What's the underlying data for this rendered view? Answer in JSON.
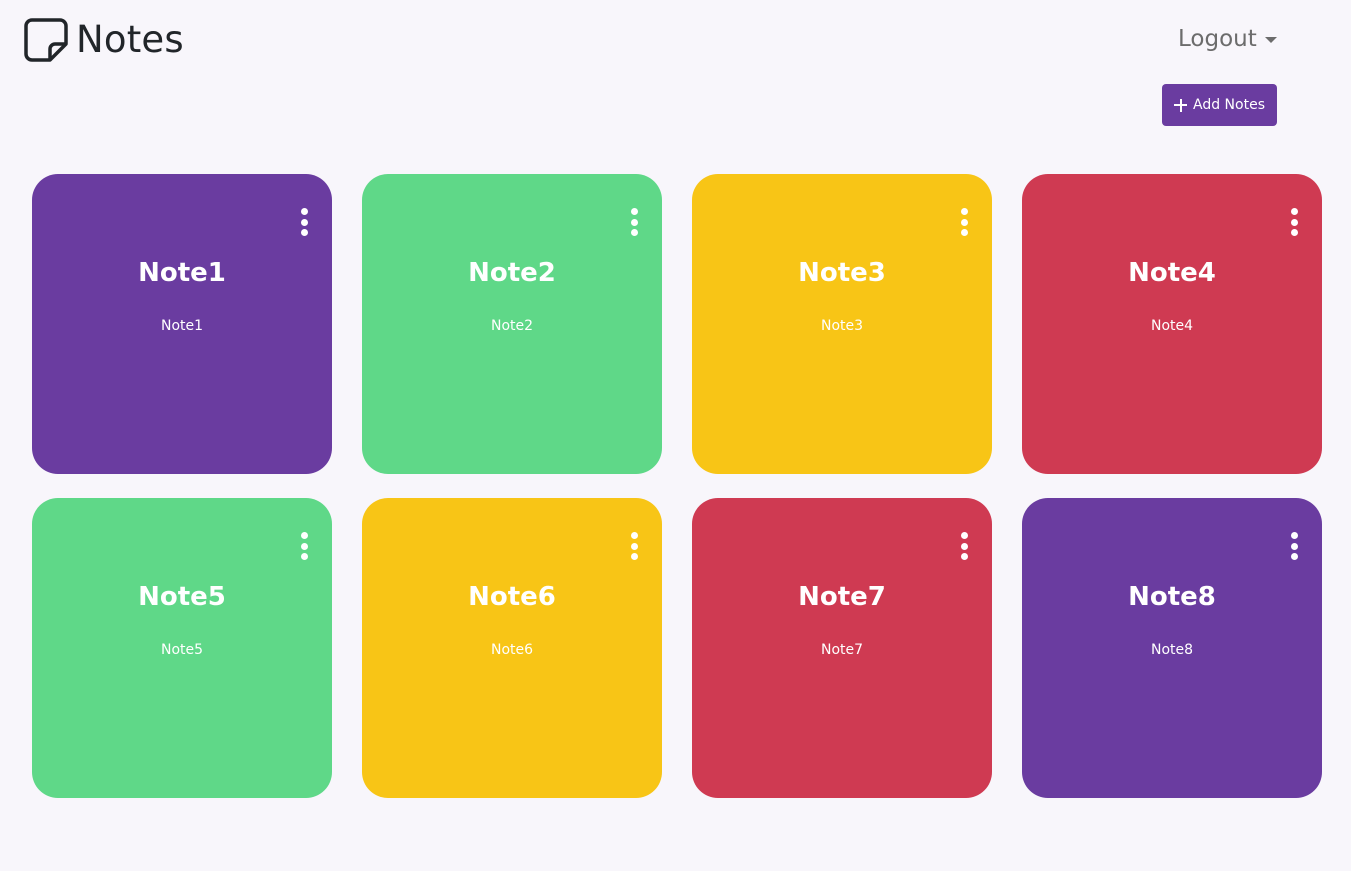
{
  "header": {
    "app_title": "Notes",
    "logo_icon": "sticky-note-icon",
    "logout_label": "Logout",
    "caret_icon": "caret-down-icon"
  },
  "toolbar": {
    "add_label": "Add Notes",
    "add_icon": "plus-icon",
    "add_color": "#6a3ca0"
  },
  "colors": {
    "purple": "#6a3ca0",
    "green": "#5fd888",
    "yellow": "#f8c516",
    "red": "#cf3a52"
  },
  "notes": [
    {
      "title": "Note1",
      "body": "Note1",
      "color": "#6a3ca0"
    },
    {
      "title": "Note2",
      "body": "Note2",
      "color": "#5fd888"
    },
    {
      "title": "Note3",
      "body": "Note3",
      "color": "#f8c516"
    },
    {
      "title": "Note4",
      "body": "Note4",
      "color": "#cf3a52"
    },
    {
      "title": "Note5",
      "body": "Note5",
      "color": "#5fd888"
    },
    {
      "title": "Note6",
      "body": "Note6",
      "color": "#f8c516"
    },
    {
      "title": "Note7",
      "body": "Note7",
      "color": "#cf3a52"
    },
    {
      "title": "Note8",
      "body": "Note8",
      "color": "#6a3ca0"
    }
  ]
}
